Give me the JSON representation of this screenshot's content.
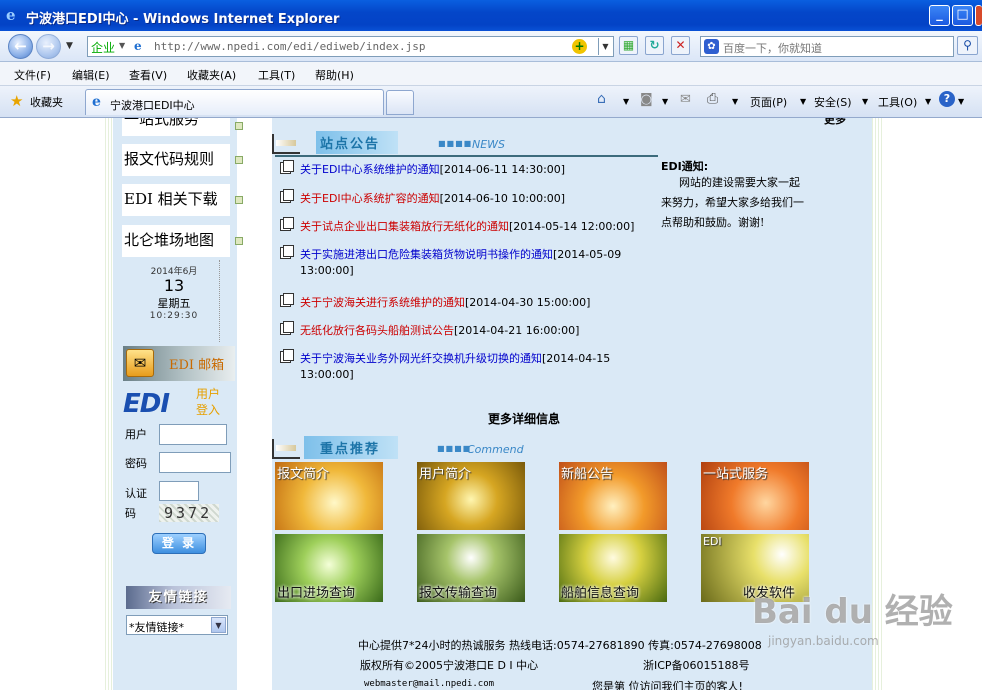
{
  "window": {
    "title": "宁波港口EDI中心 - Windows Internet Explorer",
    "min": "_",
    "max": "□",
    "close": "✕"
  },
  "navbar": {
    "zone": "企业",
    "url": "http://www.npedi.com/edi/ediweb/index.jsp",
    "search_placeholder": "百度一下，你就知道"
  },
  "menu": [
    "文件(F)",
    "编辑(E)",
    "查看(V)",
    "收藏夹(A)",
    "工具(T)",
    "帮助(H)"
  ],
  "favbar": {
    "favorites": "收藏夹",
    "tab_label": "宁波港口EDI中心",
    "page": "页面(P)",
    "safety": "安全(S)",
    "tools": "工具(O)"
  },
  "left": {
    "links": [
      "一站式服务",
      "报文代码规则",
      "EDI 相关下载",
      "北仑堆场地图"
    ],
    "calendar": {
      "date": "2014年6月",
      "day": "13",
      "weekday": "星期五",
      "time": "10:29:30"
    },
    "mail_label": "EDI 邮箱",
    "login_logo": "EDI",
    "login_title_1": "用户",
    "login_title_2": "登入",
    "user_label": "用户",
    "password_label": "密码",
    "captcha_label_1": "认证",
    "captcha_label_2": "码",
    "captcha": "9372",
    "login_button": "登 录",
    "friends_banner": "友情链接",
    "friends_select": "*友情链接*"
  },
  "notices": {
    "header": "站点公告",
    "header_en": "NEWS",
    "items": [
      {
        "title": "关于EDI中心系统维护的通知",
        "date": "[2014-06-11 14:30:00]",
        "color": "blue"
      },
      {
        "title": "关于EDI中心系统扩容的通知",
        "date": "[2014-06-10 10:00:00]",
        "color": "red"
      },
      {
        "title": "关于试点企业出口集装箱放行无纸化的通知",
        "date": "[2014-05-14 12:00:00]",
        "color": "red"
      },
      {
        "title": "关于实施进港出口危险集装箱货物说明书操作的通知",
        "date": "[2014-05-09 13:00:00]",
        "color": "blue"
      },
      {
        "title": "关于宁波海关进行系统维护的通知",
        "date": "[2014-04-30 15:00:00]",
        "color": "red"
      },
      {
        "title": "无纸化放行各码头船舶测试公告",
        "date": "[2014-04-21 16:00:00]",
        "color": "red"
      },
      {
        "title": "关于宁波海关业务外网光纤交换机升级切换的通知",
        "date": "[2014-04-15 13:00:00]",
        "color": "blue"
      }
    ],
    "more": "更多详细信息"
  },
  "edi_notice": {
    "title": "EDI通知:",
    "body": "网站的建设需要大家一起来努力，希望大家多给我们一点帮助和鼓励。谢谢!",
    "corner": "更多"
  },
  "recommend": {
    "header": "重点推荐",
    "header_en": "Commend",
    "tiles": [
      {
        "label": "报文简介",
        "pos": "top"
      },
      {
        "label": "用户简介",
        "pos": "top"
      },
      {
        "label": "新船公告",
        "pos": "top"
      },
      {
        "label": "一站式服务",
        "pos": "top"
      },
      {
        "label": "出口进场查询",
        "pos": "bottom"
      },
      {
        "label": "报文传输查询",
        "pos": "bottom"
      },
      {
        "label": "船舶信息查询",
        "pos": "bottom"
      },
      {
        "label": "收发软件",
        "pos": "bottom",
        "top_label": "EDI"
      }
    ]
  },
  "footer": {
    "line1": "中心提供7*24小时的热诚服务 热线电话:0574-27681890 传真:0574-27698008",
    "line2": "版权所有©2005宁波港口E D I 中心",
    "icp": "浙ICP备06015188号",
    "email": "webmaster@mail.npedi.com",
    "visitor": "您是第 位访问我们主页的客人!"
  },
  "watermark": "Bai du 经验",
  "watermark_sub": "jingyan.baidu.com"
}
